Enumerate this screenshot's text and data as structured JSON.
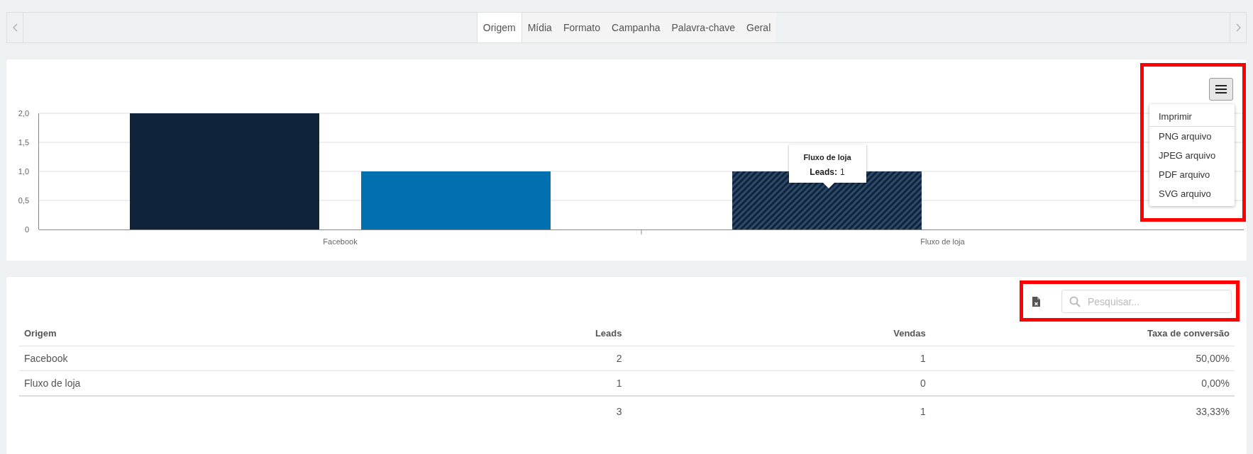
{
  "tabs": [
    {
      "label": "Origem",
      "selected": true
    },
    {
      "label": "Mídia",
      "selected": false
    },
    {
      "label": "Formato",
      "selected": false
    },
    {
      "label": "Campanha",
      "selected": false
    },
    {
      "label": "Palavra-chave",
      "selected": false
    },
    {
      "label": "Geral",
      "selected": false
    }
  ],
  "chart": {
    "export_menu": {
      "highlighted": true,
      "items": [
        "Imprimir",
        "PNG arquivo",
        "JPEG arquivo",
        "PDF arquivo",
        "SVG arquivo"
      ]
    },
    "tooltip": {
      "title": "Fluxo de loja",
      "label": "Leads:",
      "value": "1"
    },
    "chart_data": {
      "type": "bar",
      "categories": [
        "Facebook",
        "Fluxo de loja"
      ],
      "series": [
        {
          "color": "#0f243b",
          "values": [
            2,
            1
          ]
        },
        {
          "color": "#0070b0",
          "values": [
            1,
            0
          ]
        }
      ],
      "ylim": [
        0,
        2
      ],
      "grid": true,
      "yticks": [
        {
          "value": 0,
          "label": "0"
        },
        {
          "value": 0.5,
          "label": "0,5"
        },
        {
          "value": 1,
          "label": "1,0"
        },
        {
          "value": 1.5,
          "label": "1,5"
        },
        {
          "value": 2,
          "label": "2,0"
        }
      ]
    }
  },
  "table": {
    "toolbar": {
      "highlighted": true,
      "search": {
        "placeholder": "Pesquisar..."
      }
    },
    "columns": [
      "Origem",
      "Leads",
      "Vendas",
      "Taxa de conversão"
    ],
    "rows": [
      [
        "Facebook",
        "2",
        "1",
        "50,00%"
      ],
      [
        "Fluxo de loja",
        "1",
        "0",
        "0,00%"
      ]
    ],
    "totals": [
      "3",
      "1",
      "33,33%"
    ]
  }
}
